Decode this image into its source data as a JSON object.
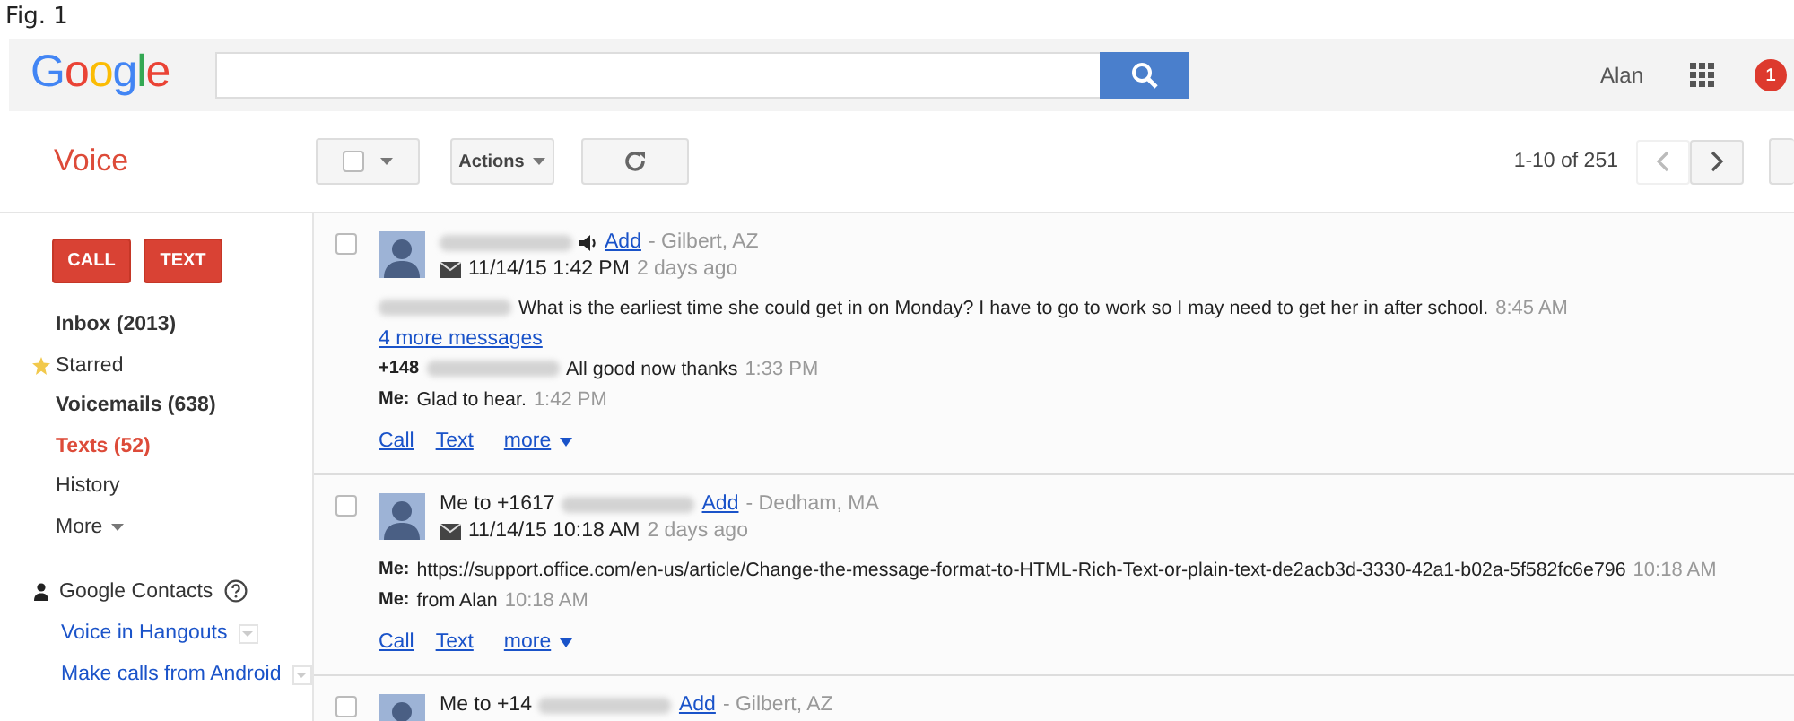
{
  "caption": "Fig. 1",
  "header": {
    "logo": "Google",
    "user": "Alan",
    "notifications": "1"
  },
  "toolbar": {
    "app_title": "Voice",
    "select_all": {
      "checked": false
    },
    "actions": "Actions",
    "pagination": "1-10 of 251"
  },
  "sidebar": {
    "buttons": [
      "CALL",
      "TEXT"
    ],
    "items": [
      {
        "label": "Inbox (2013)",
        "kind": "folder",
        "unread": true,
        "selected": false
      },
      {
        "label": "Starred",
        "kind": "starred",
        "unread": false,
        "selected": false
      },
      {
        "label": "Voicemails (638)",
        "kind": "folder",
        "unread": true,
        "selected": false
      },
      {
        "label": "Texts (52)",
        "kind": "folder",
        "unread": true,
        "selected": true
      },
      {
        "label": "History",
        "kind": "folder",
        "unread": false,
        "selected": false
      },
      {
        "label": "More",
        "kind": "menu",
        "unread": false,
        "selected": false
      }
    ],
    "contacts": "Google Contacts",
    "links": [
      "Voice in Hangouts",
      "Make calls from Android"
    ]
  },
  "conversations": [
    {
      "checked": false,
      "audio": true,
      "add": "Add",
      "location": "- Gilbert, AZ",
      "date": "11/14/15 1:42 PM",
      "ago": "2 days ago",
      "messages": [
        {
          "kind": "message",
          "redacted": true,
          "text": "What is the earliest time she could get in on Monday? I have to go to work so I may need to get her in after school.",
          "time": "8:45 AM"
        },
        {
          "kind": "more",
          "text": "4 more messages"
        },
        {
          "kind": "message",
          "sender": "+148",
          "redacted": true,
          "text": "All good now thanks",
          "time": "1:33 PM"
        },
        {
          "kind": "message",
          "sender": "Me:",
          "redacted": false,
          "text": "Glad to hear.",
          "time": "1:42 PM"
        }
      ],
      "actions": [
        "Call",
        "Text",
        "more"
      ]
    },
    {
      "checked": false,
      "caller": "Me to +1617",
      "audio": false,
      "add": "Add",
      "location": "- Dedham, MA",
      "date": "11/14/15 10:18 AM",
      "ago": "2 days ago",
      "messages": [
        {
          "kind": "message",
          "sender": "Me:",
          "redacted": false,
          "text": "https://support.office.com/en-us/article/Change-the-message-format-to-HTML-Rich-Text-or-plain-text-de2acb3d-3330-42a1-b02a-5f582fc6e796",
          "time": "10:18 AM"
        },
        {
          "kind": "message",
          "sender": "Me:",
          "redacted": false,
          "text": "from Alan",
          "time": "10:18 AM"
        }
      ],
      "actions": [
        "Call",
        "Text",
        "more"
      ]
    },
    {
      "checked": false,
      "caller": "Me to +14",
      "audio": false,
      "add": "Add",
      "location": "- Gilbert, AZ"
    }
  ]
}
